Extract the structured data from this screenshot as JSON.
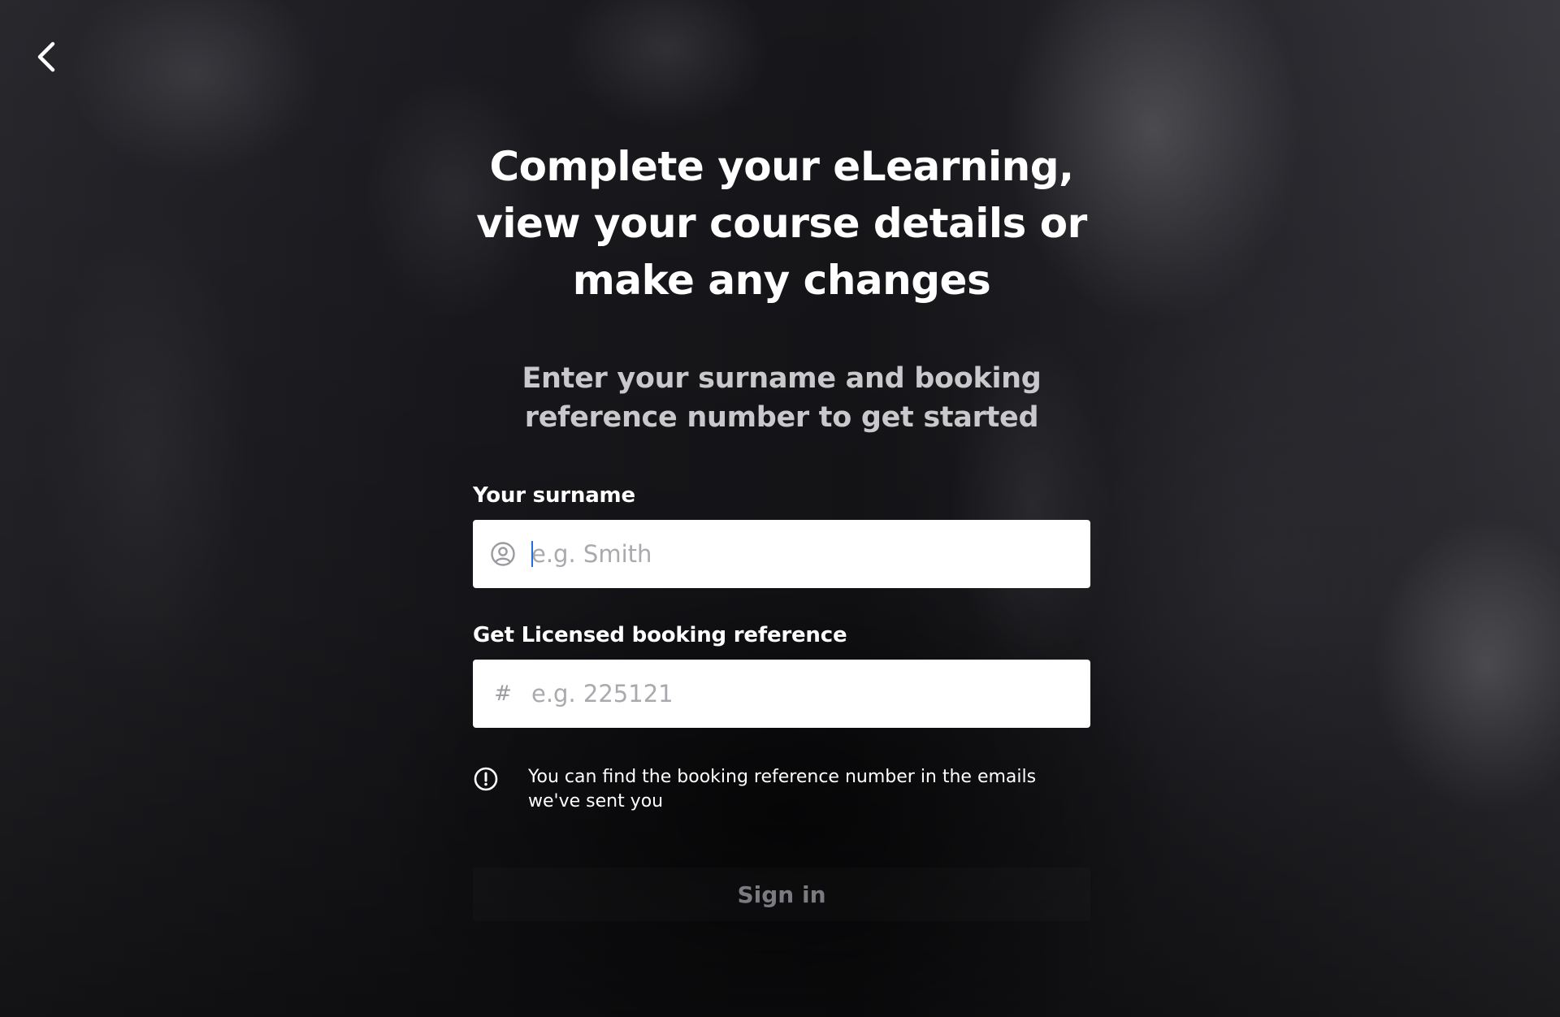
{
  "nav": {
    "back_icon": "chevron-left-icon"
  },
  "main": {
    "heading": "Complete your eLearning, view your course details or make any changes",
    "subheading": "Enter your surname and booking reference number to get started"
  },
  "form": {
    "surname": {
      "label": "Your surname",
      "placeholder": "e.g. Smith",
      "value": "",
      "icon": "user-circle-icon"
    },
    "booking_reference": {
      "label": "Get Licensed booking reference",
      "placeholder": "e.g. 225121",
      "value": "",
      "icon": "hash-icon",
      "icon_glyph": "#"
    },
    "notice": {
      "icon": "info-circle-icon",
      "text": "You can find the booking reference number in the emails we've sent you"
    },
    "submit_label": "Sign in"
  },
  "colors": {
    "background": "#141418",
    "text_primary": "#ffffff",
    "text_secondary": "#c9c9cc",
    "input_bg": "#ffffff",
    "placeholder": "#a9a9ae",
    "caret": "#1f6fe0",
    "button_text_disabled": "#7a7a80"
  }
}
